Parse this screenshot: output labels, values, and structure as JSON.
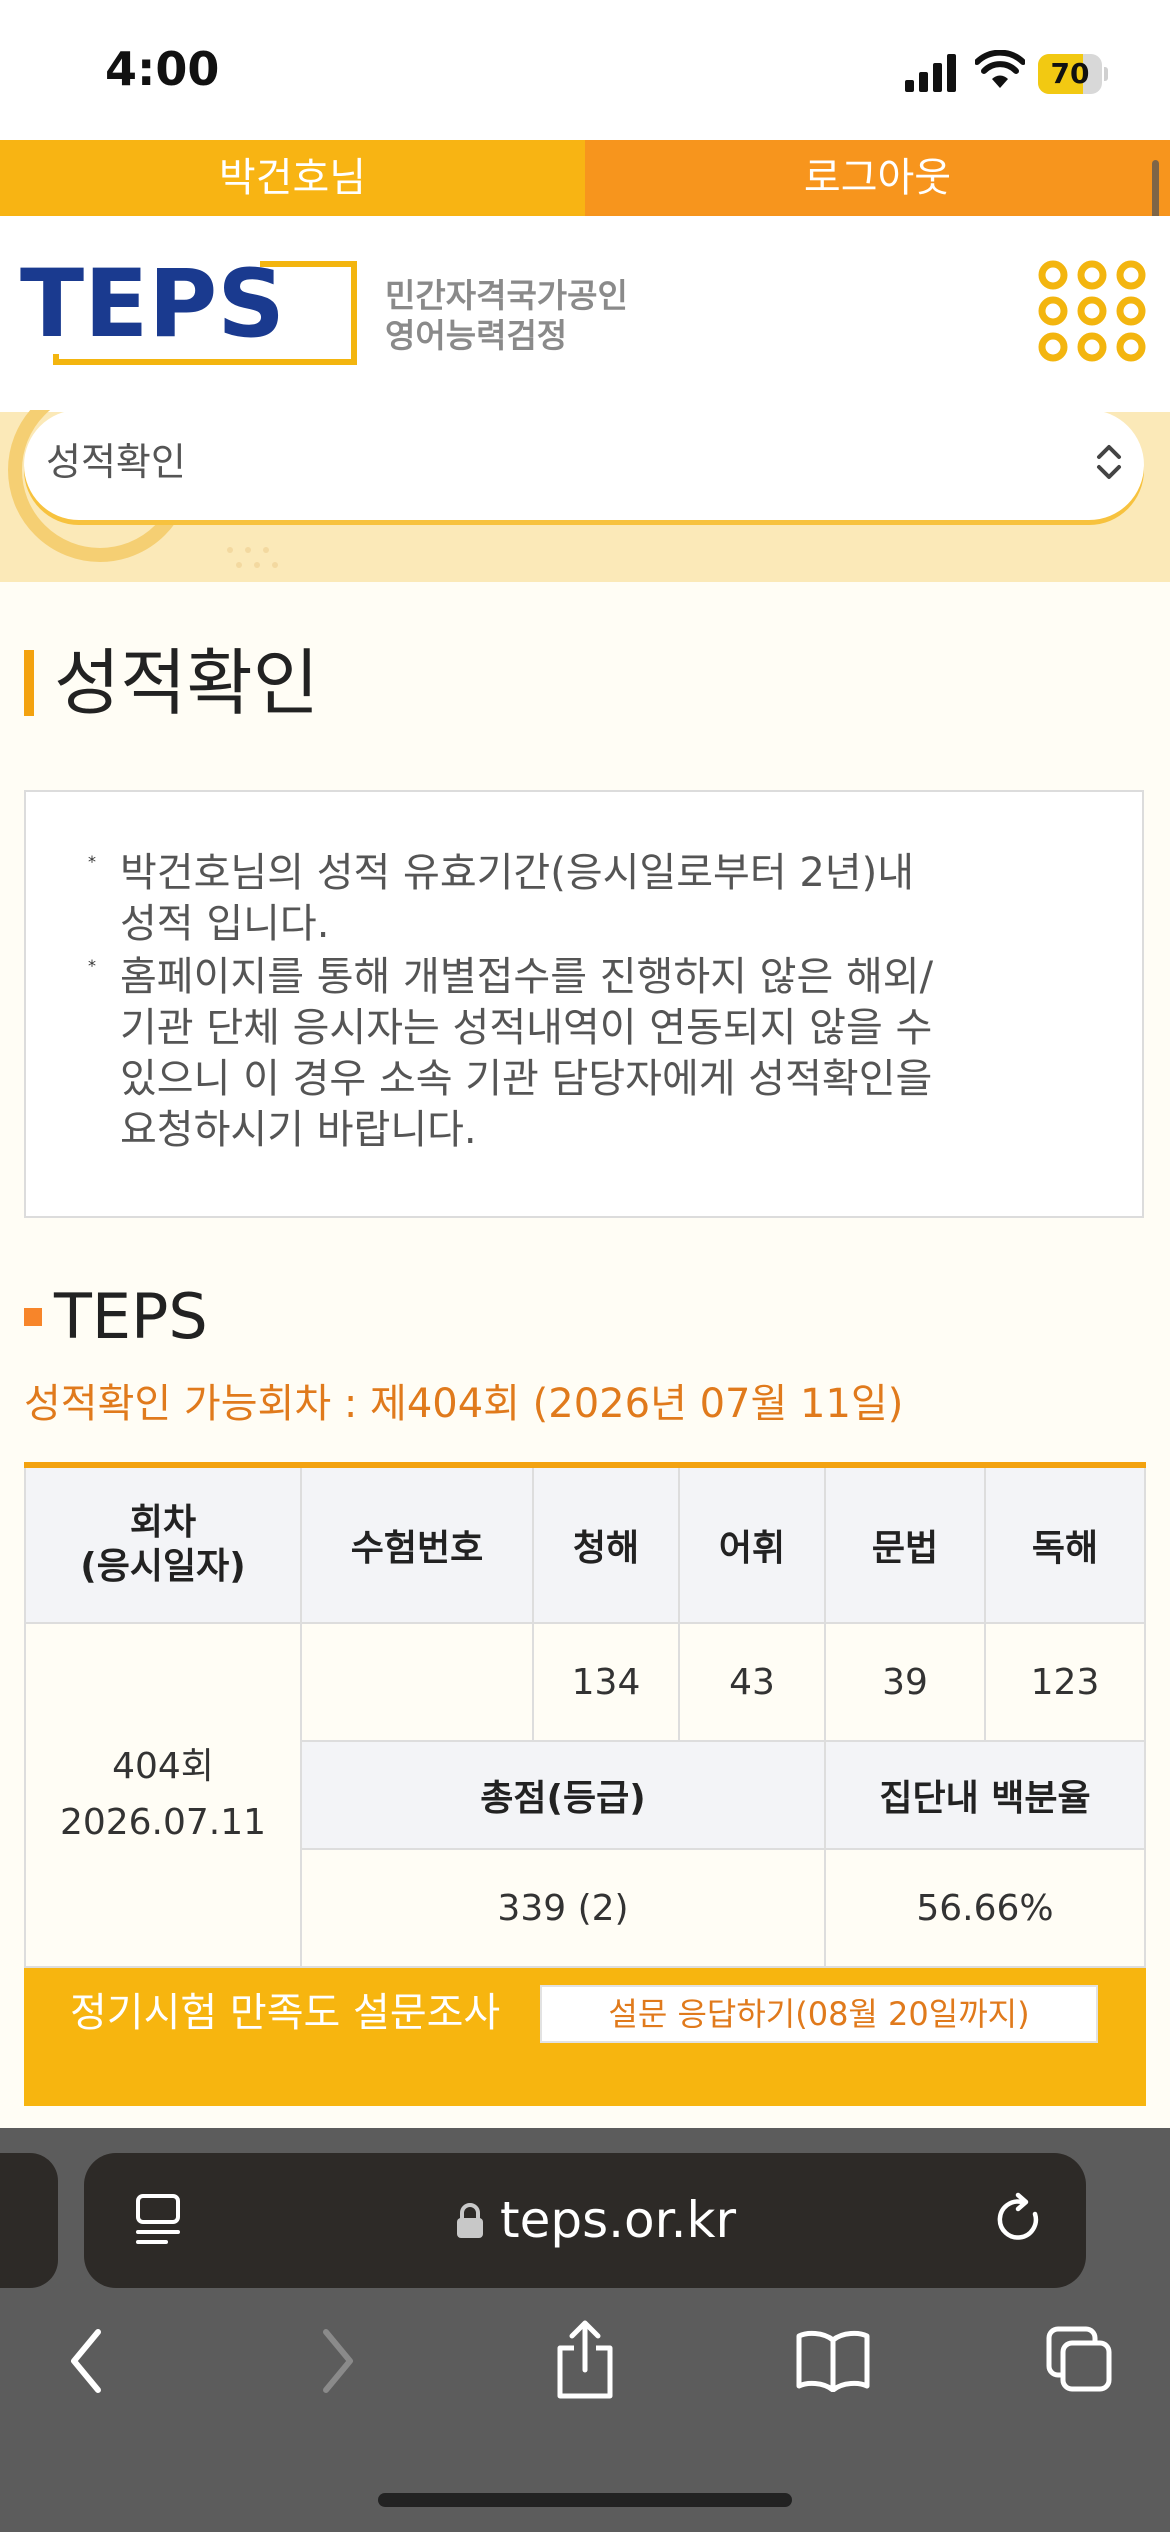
{
  "status_bar": {
    "time": "4:00",
    "battery": "70",
    "battery_level": 0.7
  },
  "user_bar": {
    "user_name": "박건호님",
    "logout_label": "로그아웃"
  },
  "header": {
    "logo_text": "TEPS",
    "tagline_line1": "민간자격국가공인",
    "tagline_line2": "영어능력검정"
  },
  "menu_select": {
    "selected": "성적확인"
  },
  "page_title": "성적확인",
  "notice": {
    "items": [
      {
        "bullet": "*",
        "lines": [
          "박건호님의 성적 유효기간(응시일로부터 2년)내",
          "성적 입니다."
        ]
      },
      {
        "bullet": "*",
        "lines": [
          "홈페이지를 통해 개별접수를 진행하지 않은 해외/",
          "기관 단체 응시자는 성적내역이 연동되지 않을 수",
          "있으니 이 경우 소속 기관 담당자에게 성적확인을",
          "요청하시기 바랍니다."
        ]
      }
    ]
  },
  "section": {
    "title": "TEPS",
    "available_session": "성적확인 가능회차 : 제404회 (2026년 07월 11일)"
  },
  "score_table": {
    "headers": {
      "session_line1": "회차",
      "session_line2": "(응시일자)",
      "exam_number": "수험번호",
      "listening": "청해",
      "vocabulary": "어휘",
      "grammar": "문법",
      "reading": "독해",
      "total": "총점(등급)",
      "percentile": "집단내 백분율"
    },
    "row": {
      "session": "404회",
      "date": "2026.07.11",
      "exam_number": "",
      "listening": "134",
      "vocabulary": "43",
      "grammar": "39",
      "reading": "123",
      "total": "339 (2)",
      "percentile": "56.66%"
    }
  },
  "survey": {
    "text": "정기시험 만족도 설문조사",
    "button": "설문 응답하기(08월 20일까지)"
  },
  "browser": {
    "url": "teps.or.kr"
  },
  "colors": {
    "primary_yellow": "#f8b413",
    "primary_orange": "#f7951d",
    "accent_orange": "#e07a1c",
    "logo_navy": "#1a3a8f"
  }
}
